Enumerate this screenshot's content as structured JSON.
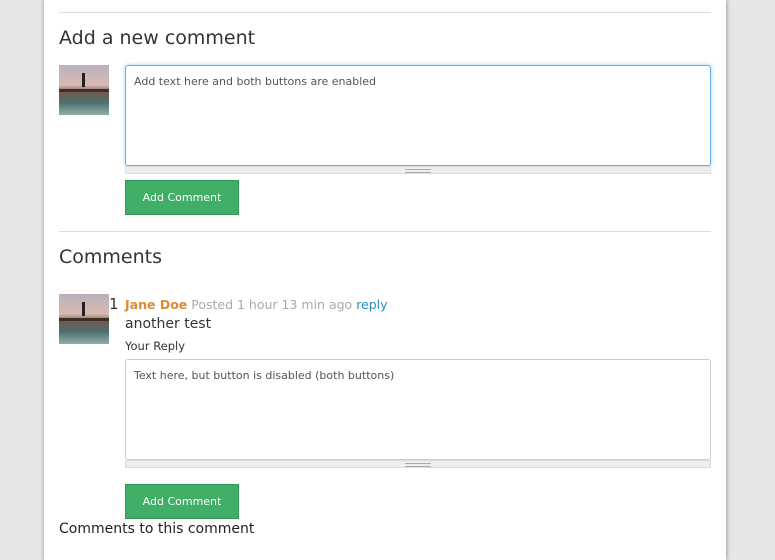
{
  "new_comment": {
    "heading": "Add a new comment",
    "textarea_value": "Add text here and both buttons are enabled",
    "button_label": "Add Comment"
  },
  "comments": {
    "heading": "Comments",
    "items": [
      {
        "number": "1",
        "author": "Jane Doe",
        "posted": "Posted 1 hour 13 min ago",
        "reply_link": "reply",
        "text": "another test",
        "reply_label": "Your Reply",
        "reply_value": "Text here, but button is disabled (both buttons)",
        "button_label": "Add Comment",
        "subcomments_heading": "Comments to this comment"
      }
    ]
  }
}
